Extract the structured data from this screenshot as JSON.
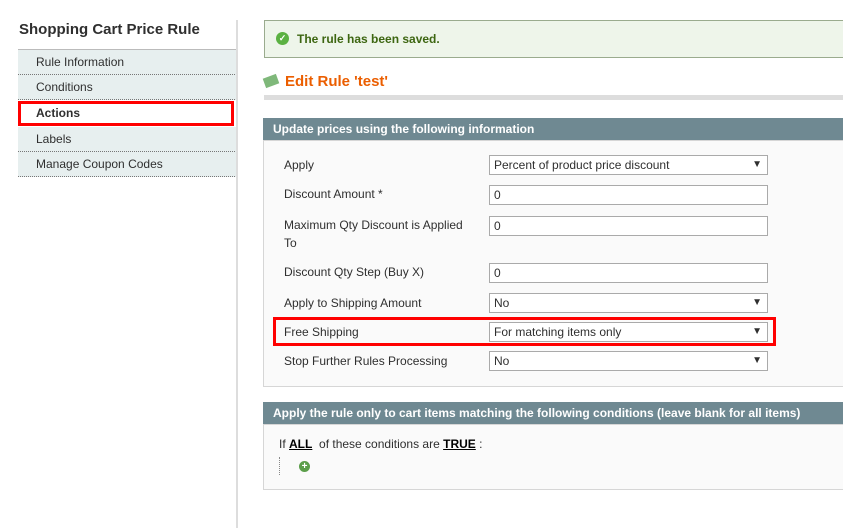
{
  "sidebar": {
    "title": "Shopping Cart Price Rule",
    "items": [
      {
        "label": "Rule Information"
      },
      {
        "label": "Conditions"
      },
      {
        "label": "Actions"
      },
      {
        "label": "Labels"
      },
      {
        "label": "Manage Coupon Codes"
      }
    ]
  },
  "message": {
    "text": "The rule has been saved.",
    "icon": "success-check-icon"
  },
  "heading": {
    "title": "Edit Rule 'test'",
    "icon": "money-icon"
  },
  "actions": {
    "header": "Update prices using the following information",
    "fields": [
      {
        "label": "Apply",
        "value": "Percent of product price discount",
        "type": "select"
      },
      {
        "label": "Discount Amount *",
        "value": "0",
        "type": "text"
      },
      {
        "label": "Maximum Qty Discount is Applied To",
        "value": "0",
        "type": "text"
      },
      {
        "label": "Discount Qty Step (Buy X)",
        "value": "0",
        "type": "text"
      },
      {
        "label": "Apply to Shipping Amount",
        "value": "No",
        "type": "select"
      },
      {
        "label": "Free Shipping",
        "value": "For matching items only",
        "type": "select"
      },
      {
        "label": "Stop Further Rules Processing",
        "value": "No",
        "type": "select"
      }
    ]
  },
  "conditions": {
    "header": "Apply the rule only to cart items matching the following conditions (leave blank for all items)",
    "prefix": "If",
    "aggregator": "ALL",
    "middle": "of these conditions are",
    "value": "TRUE",
    "suffix": ":"
  },
  "colors": {
    "header": "#6f8992",
    "title": "#eb5e00",
    "highlight": "#ff0000"
  }
}
